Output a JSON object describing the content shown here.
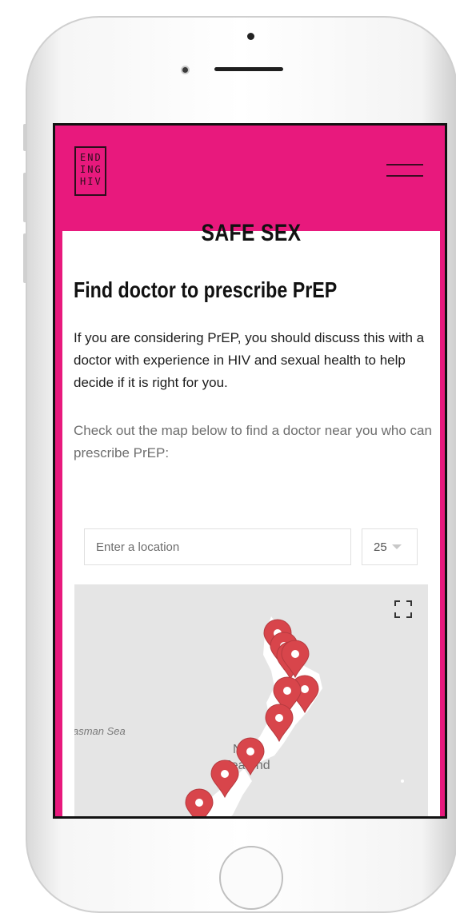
{
  "header": {
    "logo_lines": [
      "END",
      "ING",
      "HIV"
    ],
    "menu_icon": "hamburger-menu-icon"
  },
  "page": {
    "section_title": "SAFE SEX",
    "heading": "Find doctor to prescribe PrEP",
    "intro": "If you are considering PrEP, you should discuss this with a doctor with experience in HIV and sexual health to help decide if it is right for you.",
    "map_intro": "Check out the map below to find a doctor near you who can prescribe PrEP:"
  },
  "search": {
    "placeholder": "Enter a location",
    "radius_value": "25"
  },
  "map": {
    "label_sea": "asman Sea",
    "label_country_line1": "N",
    "label_country_line2": "Zea   nd",
    "marker_color": "#d8454b",
    "fullscreen_icon": "fullscreen-icon"
  },
  "colors": {
    "brand_pink": "#e8197d",
    "marker_red": "#d8454b"
  }
}
